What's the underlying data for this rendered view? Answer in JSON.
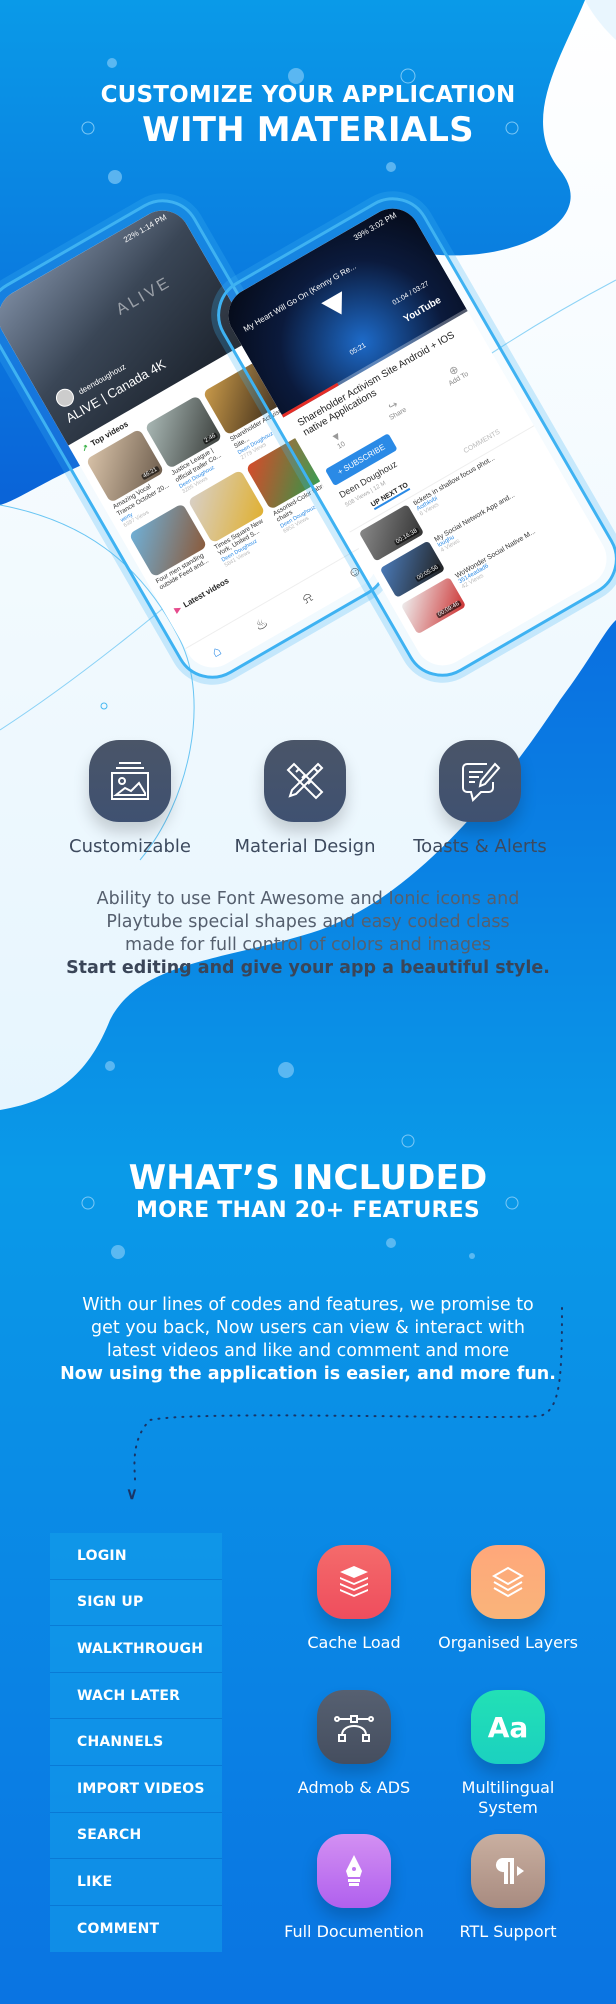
{
  "section1": {
    "title_line1": "CUSTOMIZE YOUR APPLICATION",
    "title_line2": "WITH MATERIALS",
    "features": [
      {
        "label": "Customizable",
        "icon": "image-gallery-icon"
      },
      {
        "label": "Material Design",
        "icon": "pencil-ruler-icon"
      },
      {
        "label": "Toasts & Alerts",
        "icon": "chat-edit-icon"
      }
    ],
    "description_lines": [
      "Ability to use Font Awesome and Ionic icons and",
      "Playtube special shapes and easy coded class",
      "made for full control of colors and images"
    ],
    "description_bold": "Start editing and give your app a beautiful style."
  },
  "phone_left": {
    "status": "22% 1:14 PM",
    "hero_watermark": "ALIVE",
    "hero_user": "deendoughouz",
    "hero_title": "ALIVE | Canada 4K",
    "top_videos_label": "Top videos",
    "latest_videos_label": "Latest videos",
    "videos": [
      {
        "title": "Amazing Vocal Trance October 20...",
        "author": "werty",
        "views": "6397 Views",
        "duration": "46:21"
      },
      {
        "title": "Justice League | official trailer Co...",
        "author": "Deen Doughouz",
        "views": "3285 Views",
        "duration": "2:46"
      },
      {
        "title": "Shareholder Activism Site...",
        "author": "Deen Doughouz",
        "views": "2779 Views",
        "duration": ""
      }
    ],
    "videos_row2": [
      {
        "title": "Four men standing outside Feed and...",
        "author": "",
        "views": "",
        "duration": ""
      },
      {
        "title": "Times Square New York, United S...",
        "author": "Deen Doughouz",
        "views": "5841 Views",
        "duration": ""
      },
      {
        "title": "Assorted-Color fabric chairs",
        "author": "Deen Doughouz",
        "views": "6952 Views",
        "duration": ""
      }
    ]
  },
  "phone_right": {
    "status": "39% 3:02 PM",
    "player_title": "My Heart Will Go On (Kenny G Re...",
    "time_elapsed": "05:21",
    "time_total": "01:04 / 03:27",
    "player_logo": "YouTube",
    "progress": 0.3,
    "video_title": "Shareholder Activism Site Android + IOS native Applications",
    "actions": [
      {
        "label": "10",
        "icon": "thumbs-down-icon"
      },
      {
        "label": "Share",
        "icon": "share-icon"
      },
      {
        "label": "Add To",
        "icon": "add-icon"
      }
    ],
    "subscribe_label": "+ SUBSCRIBE",
    "channel_name": "Deen Doughouz",
    "channel_meta": "508 Views | 12 M",
    "tabs": [
      "UP NEXT TO",
      "COMMENTS"
    ],
    "list": [
      {
        "title": "tickets in shallow focus phot...",
        "author": "Aothkvbi",
        "views": "6 Views",
        "duration": "00:16:38"
      },
      {
        "title": "My Social Network App and...",
        "author": "louqhu",
        "views": "4 Views",
        "duration": "00:05:56"
      },
      {
        "title": "WoWonder Social Native M...",
        "author": "3514eadad6",
        "views": "42 Views",
        "duration": "00:09:46"
      }
    ]
  },
  "section2": {
    "title_line1": "WHAT’S INCLUDED",
    "title_line2": "MORE THAN 20+ FEATURES",
    "description_lines": [
      "With our lines of codes and features, we promise to",
      "get you back, Now users can view & interact with",
      "latest videos and like and comment and more"
    ],
    "description_bold": "Now using the application is easier, and more fun.",
    "feature_list": [
      "LOGIN",
      "SIGN UP",
      "WALKTHROUGH",
      "WACH LATER",
      "CHANNELS",
      "IMPORT VIDEOS",
      "SEARCH",
      "LIKE",
      "COMMENT"
    ],
    "feature_grid": [
      {
        "label": "Cache Load",
        "icon": "stacked-layers-icon",
        "color": "#f05a63"
      },
      {
        "label": "Organised Layers",
        "icon": "outline-layers-icon",
        "color": "#fcae7a"
      },
      {
        "label": "Admob & ADS",
        "icon": "bezier-curve-icon",
        "color": "#4c5566"
      },
      {
        "label": "Multilingual System",
        "icon": "text-aa-icon",
        "glyph": "Aa",
        "color": "#1fdab8"
      },
      {
        "label": "Full Documention",
        "icon": "pen-nib-icon",
        "color": "#c479f0"
      },
      {
        "label": "RTL Support",
        "icon": "rtl-paragraph-icon",
        "color": "#b89a8d"
      }
    ]
  }
}
